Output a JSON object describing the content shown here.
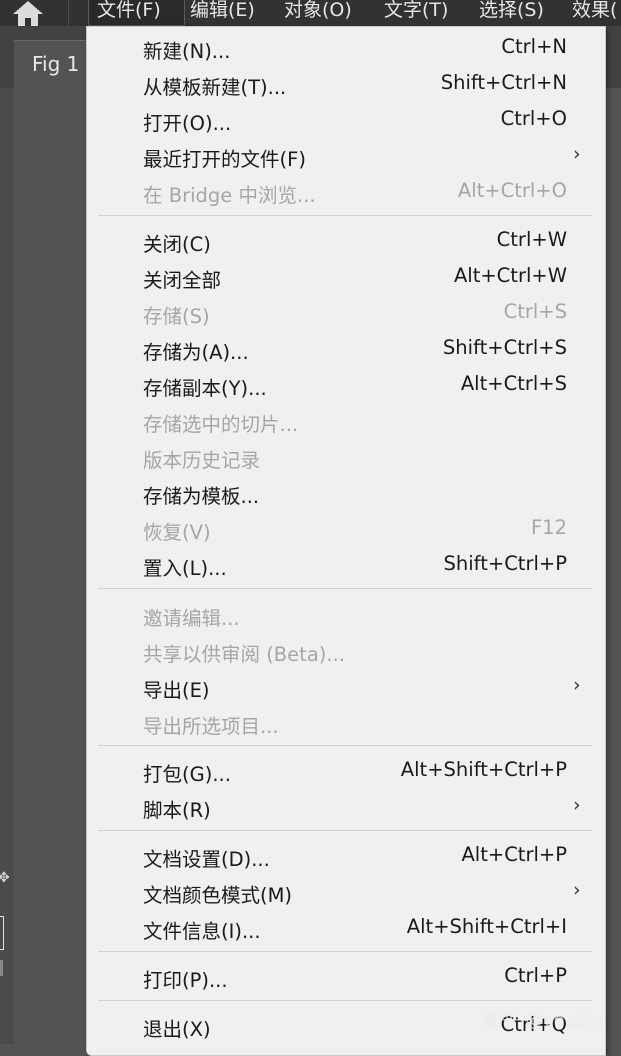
{
  "menubar": {
    "items": [
      {
        "label": "文件(F)"
      },
      {
        "label": "编辑(E)"
      },
      {
        "label": "对象(O)"
      },
      {
        "label": "文字(T)"
      },
      {
        "label": "选择(S)"
      },
      {
        "label": "效果("
      }
    ]
  },
  "document": {
    "tab_label": "Fig 1"
  },
  "file_menu": {
    "items": [
      {
        "label": "新建(N)...",
        "shortcut": "Ctrl+N"
      },
      {
        "label": "从模板新建(T)...",
        "shortcut": "Shift+Ctrl+N"
      },
      {
        "label": "打开(O)...",
        "shortcut": "Ctrl+O"
      },
      {
        "label": "最近打开的文件(F)",
        "shortcut": "",
        "submenu": "›"
      },
      {
        "label": "在 Bridge 中浏览...",
        "shortcut": "Alt+Ctrl+O",
        "disabled": true
      },
      {
        "label": "关闭(C)",
        "shortcut": "Ctrl+W"
      },
      {
        "label": "关闭全部",
        "shortcut": "Alt+Ctrl+W"
      },
      {
        "label": "存储(S)",
        "shortcut": "Ctrl+S",
        "disabled": true
      },
      {
        "label": "存储为(A)...",
        "shortcut": "Shift+Ctrl+S"
      },
      {
        "label": "存储副本(Y)...",
        "shortcut": "Alt+Ctrl+S"
      },
      {
        "label": "存储选中的切片...",
        "shortcut": "",
        "disabled": true
      },
      {
        "label": "版本历史记录",
        "shortcut": "",
        "disabled": true
      },
      {
        "label": "存储为模板...",
        "shortcut": ""
      },
      {
        "label": "恢复(V)",
        "shortcut": "F12",
        "disabled": true
      },
      {
        "label": "置入(L)...",
        "shortcut": "Shift+Ctrl+P"
      },
      {
        "label": "邀请编辑...",
        "shortcut": "",
        "disabled": true
      },
      {
        "label": "共享以供审阅 (Beta)...",
        "shortcut": "",
        "disabled": true
      },
      {
        "label": "导出(E)",
        "shortcut": "",
        "submenu": "›"
      },
      {
        "label": "导出所选项目...",
        "shortcut": "",
        "disabled": true
      },
      {
        "label": "打包(G)...",
        "shortcut": "Alt+Shift+Ctrl+P"
      },
      {
        "label": "脚本(R)",
        "shortcut": "",
        "submenu": "›"
      },
      {
        "label": "文档设置(D)...",
        "shortcut": "Alt+Ctrl+P"
      },
      {
        "label": "文档颜色模式(M)",
        "shortcut": "",
        "submenu": "›"
      },
      {
        "label": "文件信息(I)...",
        "shortcut": "Alt+Shift+Ctrl+I"
      },
      {
        "label": "打印(P)...",
        "shortcut": "Ctrl+P"
      },
      {
        "label": "退出(X)",
        "shortcut": "Ctrl+Q"
      }
    ]
  },
  "watermark": {
    "text": "知乎 @cobble"
  }
}
